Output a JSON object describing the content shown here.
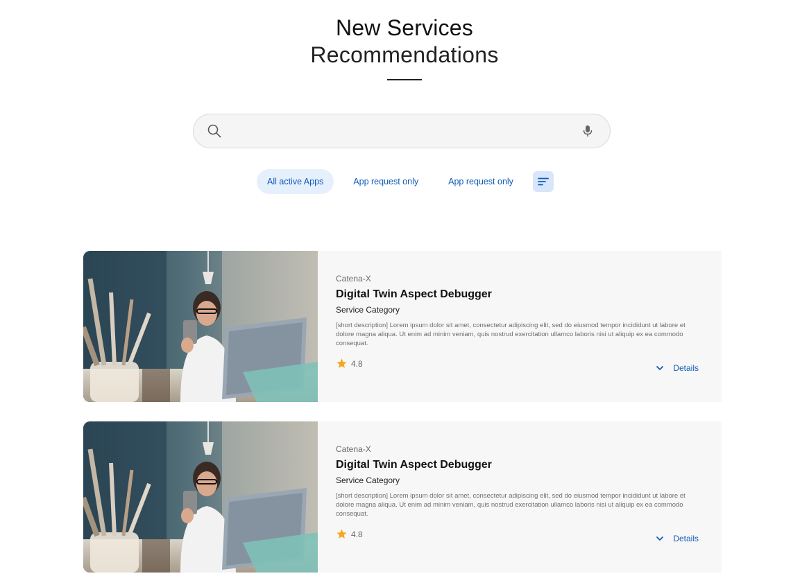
{
  "header": {
    "title": "New Services",
    "subtitle": "Recommendations"
  },
  "search": {
    "value": "",
    "placeholder": "",
    "search_icon": "search-icon",
    "mic_icon": "mic-icon"
  },
  "filters": {
    "tabs": [
      {
        "label": "All active Apps",
        "active": true
      },
      {
        "label": "App request only",
        "active": false
      },
      {
        "label": "App request only",
        "active": false
      }
    ],
    "sort_icon": "sort-icon"
  },
  "cards": [
    {
      "provider": "Catena-X",
      "title": "Digital Twin Aspect Debugger",
      "category": "Service Category",
      "description": "[short description] Lorem ipsum dolor sit amet, consectetur adipiscing elit, sed do eiusmod tempor incididunt ut labore et dolore magna aliqua. Ut enim ad minim veniam, quis nostrud exercitation ullamco laboris nisi ut aliquip ex ea commodo consequat.",
      "rating": "4.8",
      "details_label": "Details"
    },
    {
      "provider": "Catena-X",
      "title": "Digital Twin Aspect Debugger",
      "category": "Service Category",
      "description": "[short description] Lorem ipsum dolor sit amet, consectetur adipiscing elit, sed do eiusmod tempor incididunt ut labore et dolore magna aliqua. Ut enim ad minim veniam, quis nostrud exercitation ullamco laboris nisi ut aliquip ex ea commodo consequat.",
      "rating": "4.8",
      "details_label": "Details"
    }
  ],
  "colors": {
    "accent": "#0f5bb5",
    "chip_active_bg": "#e6f0fd",
    "card_bg": "#f7f7f7",
    "star": "#f5a623"
  }
}
